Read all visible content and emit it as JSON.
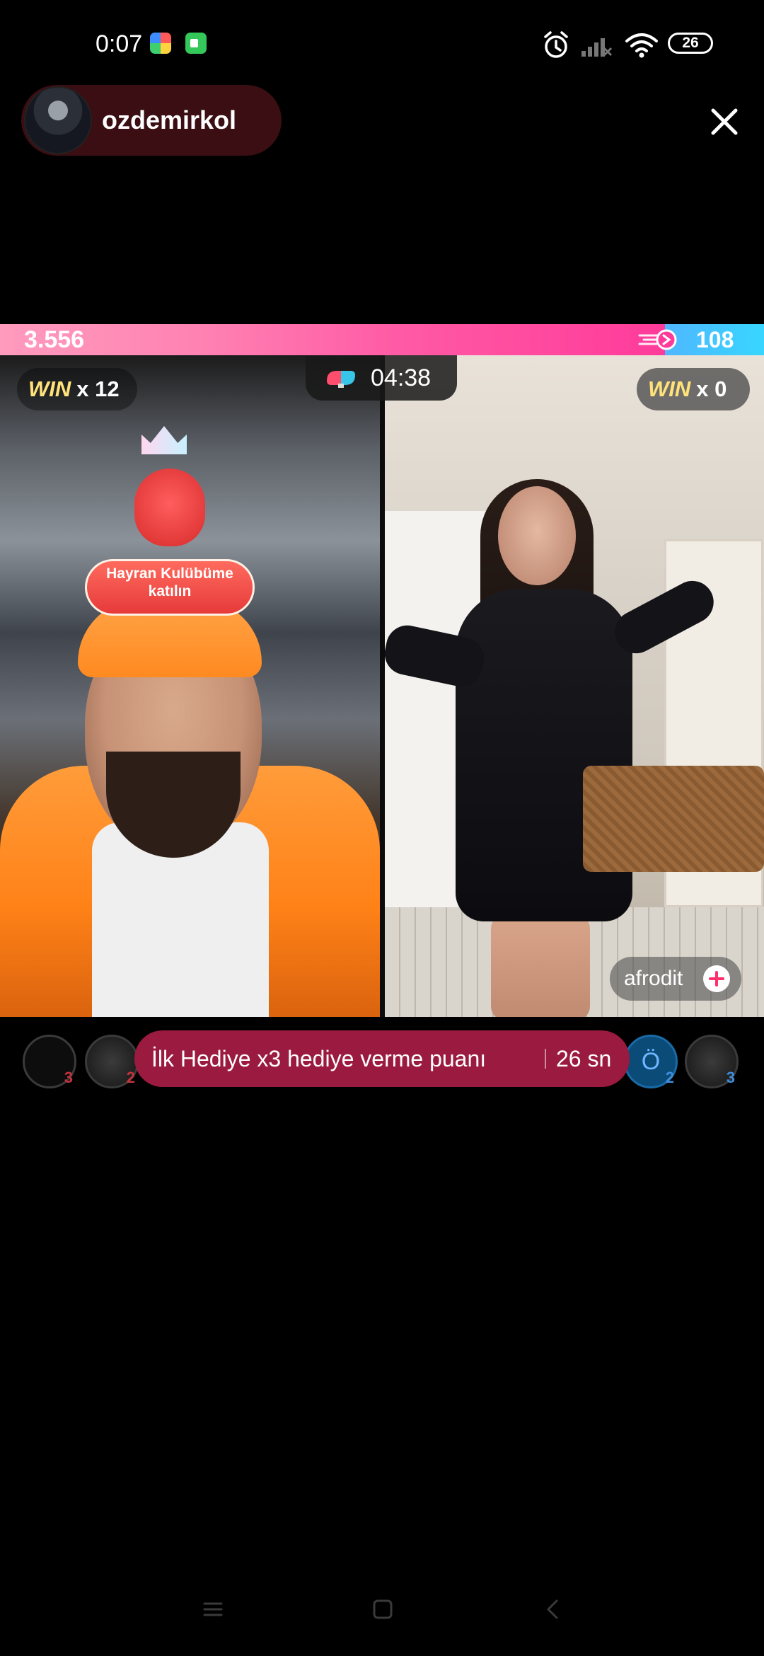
{
  "status_bar": {
    "time": "0:07",
    "battery": "26",
    "icons": [
      "photos-app-icon",
      "video-call-app-icon",
      "alarm-icon",
      "signal-icon",
      "wifi-icon",
      "battery-icon"
    ]
  },
  "host": {
    "name": "ozdemirkol",
    "avatar_icon": "host-avatar"
  },
  "close": {
    "icon": "close-icon"
  },
  "battle": {
    "left_score": "3.556",
    "right_score": "108",
    "left_share": 0.87,
    "timer": "04:38",
    "timer_icon": "boxing-gloves-icon",
    "left_win": {
      "word": "WIN",
      "multiplier": "x 12"
    },
    "right_win": {
      "word": "WIN",
      "multiplier": "x 0"
    },
    "colors": {
      "left": "#ff5aa5",
      "right": "#38d6ff",
      "win_word": "#ffe27a"
    }
  },
  "fan_club": {
    "label": "Hayran Kulübüme katılın"
  },
  "opponent": {
    "name": "afrodit",
    "follow_icon": "plus-icon"
  },
  "supporters": {
    "left": [
      {
        "rank": "3"
      },
      {
        "rank": "2"
      }
    ],
    "right": [
      {
        "letter": "Ö",
        "rank": "2"
      },
      {
        "rank": "3"
      }
    ]
  },
  "gift_banner": {
    "text": "İlk Hediye x3 hediye verme puanı",
    "timer": "26 sn",
    "color": "#9b1a3f"
  },
  "nav": {
    "menu_icon": "menu-icon",
    "home_icon": "home-icon",
    "back_icon": "back-icon"
  }
}
